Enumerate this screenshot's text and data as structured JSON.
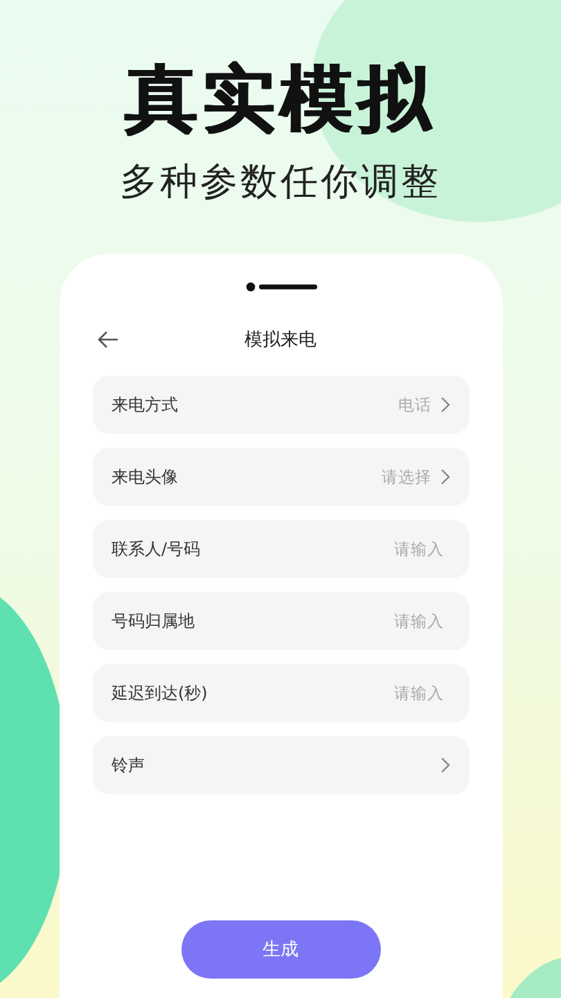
{
  "headline": "真实模拟",
  "subtitle": "多种参数任你调整",
  "screen": {
    "title": "模拟来电",
    "rows": [
      {
        "kind": "select",
        "label": "来电方式",
        "value": "电话"
      },
      {
        "kind": "select",
        "label": "来电头像",
        "value": "请选择"
      },
      {
        "kind": "input",
        "label": "联系人/号码",
        "placeholder": "请输入"
      },
      {
        "kind": "input",
        "label": "号码归属地",
        "placeholder": "请输入"
      },
      {
        "kind": "input",
        "label": "延迟到达(秒)",
        "placeholder": "请输入"
      },
      {
        "kind": "select",
        "label": "铃声"
      }
    ],
    "button": "生成"
  }
}
